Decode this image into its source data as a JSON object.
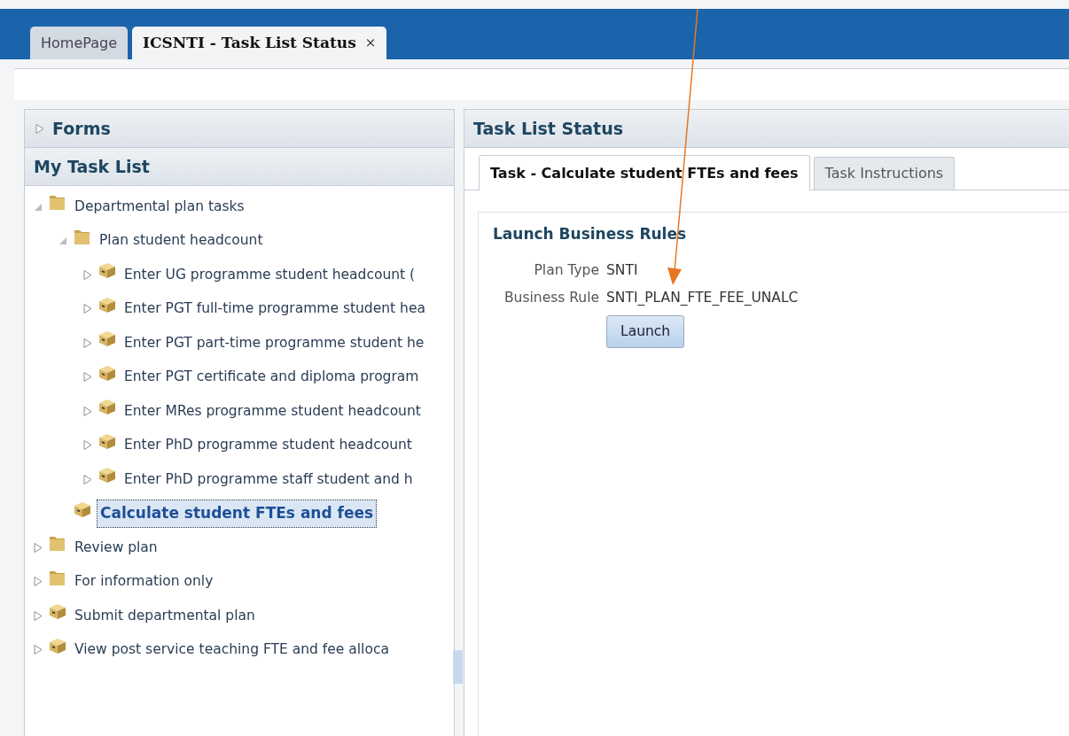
{
  "tabs": [
    {
      "label": "HomePage",
      "selected": false
    },
    {
      "label": "ICSNTI - Task List Status",
      "selected": true,
      "close": "×"
    }
  ],
  "sidebar": {
    "sections": [
      {
        "title": "Forms",
        "expanded": false
      },
      {
        "title": "My Task List",
        "expanded": true
      }
    ],
    "tree": [
      {
        "label": "Departmental plan tasks",
        "kind": "folder",
        "expandable": true,
        "expanded": true,
        "selected": false,
        "children": [
          {
            "label": "Plan student headcount",
            "kind": "folder",
            "expandable": true,
            "expanded": true,
            "selected": false,
            "children": [
              {
                "label": "Enter UG programme student headcount (",
                "kind": "task",
                "expandable": true,
                "expanded": false,
                "selected": false
              },
              {
                "label": "Enter PGT full-time programme student hea",
                "kind": "task",
                "expandable": true,
                "expanded": false,
                "selected": false
              },
              {
                "label": "Enter PGT part-time programme student he",
                "kind": "task",
                "expandable": true,
                "expanded": false,
                "selected": false
              },
              {
                "label": "Enter PGT certificate and diploma program",
                "kind": "task",
                "expandable": true,
                "expanded": false,
                "selected": false
              },
              {
                "label": "Enter MRes programme student headcount",
                "kind": "task",
                "expandable": true,
                "expanded": false,
                "selected": false
              },
              {
                "label": "Enter PhD programme student headcount",
                "kind": "task",
                "expandable": true,
                "expanded": false,
                "selected": false
              },
              {
                "label": "Enter PhD programme staff student and h",
                "kind": "task",
                "expandable": true,
                "expanded": false,
                "selected": false
              }
            ]
          },
          {
            "label": "Calculate student FTEs and fees",
            "kind": "task",
            "expandable": false,
            "selected": true
          }
        ]
      },
      {
        "label": "Review plan",
        "kind": "folder",
        "expandable": true,
        "expanded": false,
        "selected": false
      },
      {
        "label": "For information only",
        "kind": "folder",
        "expandable": true,
        "expanded": false,
        "selected": false
      },
      {
        "label": "Submit departmental plan",
        "kind": "task",
        "expandable": true,
        "expanded": false,
        "selected": false
      },
      {
        "label": "View post service teaching FTE and fee alloca",
        "kind": "task",
        "expandable": true,
        "expanded": false,
        "selected": false
      }
    ]
  },
  "main": {
    "title": "Task List Status",
    "tabs": [
      {
        "label": "Task - Calculate student FTEs and fees",
        "selected": true
      },
      {
        "label": "Task Instructions",
        "selected": false
      }
    ],
    "section_title": "Launch Business Rules",
    "fields": [
      {
        "label": "Plan Type",
        "value": "SNTI"
      },
      {
        "label": "Business Rule",
        "value": "SNTI_PLAN_FTE_FEE_UNALC"
      }
    ],
    "button": "Launch"
  }
}
